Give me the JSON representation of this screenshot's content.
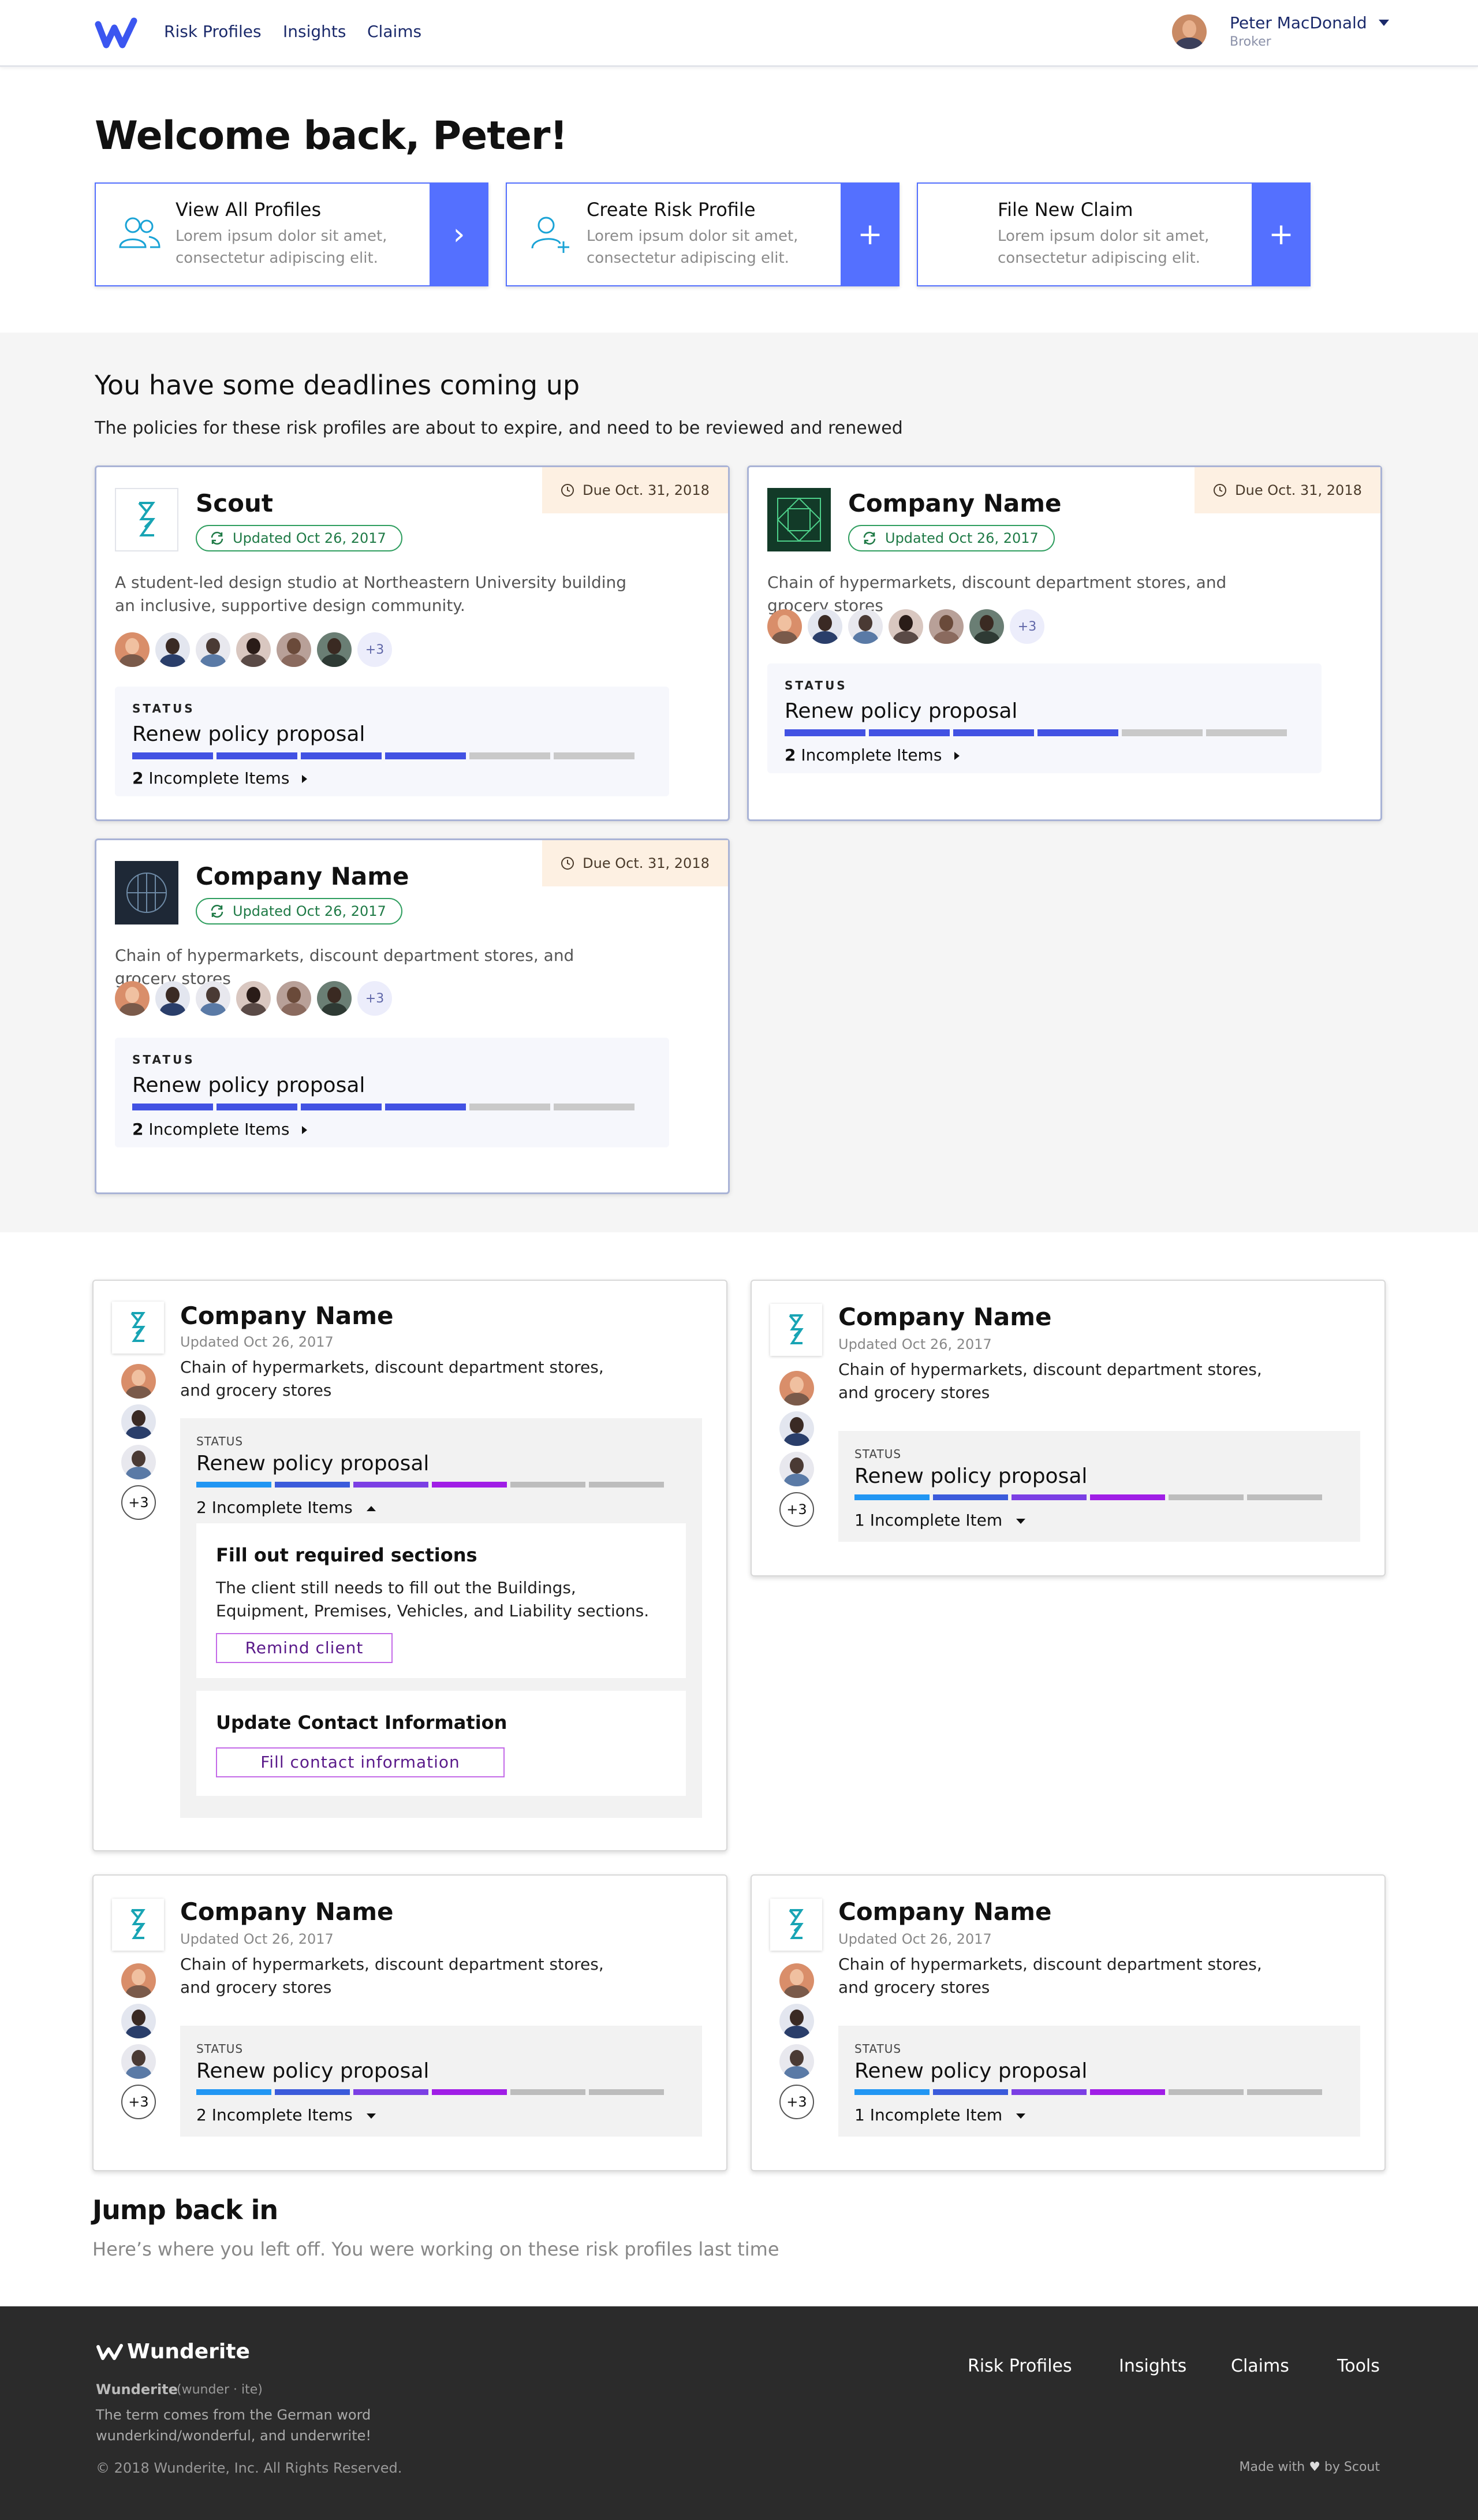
{
  "header": {
    "nav": [
      "Risk Profiles",
      "Insights",
      "Claims"
    ],
    "user_name": "Peter MacDonald",
    "user_role": "Broker"
  },
  "welcome": "Welcome back, Peter!",
  "quick_actions": [
    {
      "title": "View All Profiles",
      "desc": "Lorem ipsum dolor sit amet, consectetur adipiscing elit.",
      "button": "›"
    },
    {
      "title": "Create Risk Profile",
      "desc": "Lorem ipsum dolor sit amet, consectetur adipiscing elit.",
      "button": "+"
    },
    {
      "title": "File New Claim",
      "desc": "Lorem ipsum dolor sit amet, consectetur adipiscing elit.",
      "button": "+"
    }
  ],
  "deadlines": {
    "title": "You have some deadlines coming up",
    "subtitle": "The policies for these risk profiles are about to expire, and need to be reviewed and renewed",
    "cards": [
      {
        "name": "Scout",
        "due": "Due Oct. 31, 2018",
        "updated": "Updated Oct 26, 2017",
        "desc": "A student-led design studio at Northeastern University building an inclusive, supportive design community.",
        "more": "+3",
        "status_label": "STATUS",
        "phase": "Renew policy proposal",
        "progress": 0.67,
        "incomplete_count": "2",
        "incomplete_text": "Incomplete Items"
      },
      {
        "name": "Company Name",
        "due": "Due Oct. 31, 2018",
        "updated": "Updated Oct 26, 2017",
        "desc": "Chain of hypermarkets, discount department stores, and grocery stores",
        "more": "+3",
        "status_label": "STATUS",
        "phase": "Renew policy proposal",
        "progress": 0.67,
        "incomplete_count": "2",
        "incomplete_text": "Incomplete Items"
      },
      {
        "name": "Company Name",
        "due": "Due Oct. 31, 2018",
        "updated": "Updated Oct 26, 2017",
        "desc": "Chain of hypermarkets, discount department stores, and grocery stores",
        "more": "+3",
        "status_label": "STATUS",
        "phase": "Renew policy proposal",
        "progress": 0.67,
        "incomplete_count": "2",
        "incomplete_text": "Incomplete Items"
      }
    ]
  },
  "profiles": [
    {
      "name": "Company Name",
      "updated": "Updated Oct 26, 2017",
      "desc": "Chain of hypermarkets, discount department stores, and grocery stores",
      "more": "+3",
      "status_label": "STATUS",
      "phase": "Renew policy proposal",
      "incomplete": "2 Incomplete Items",
      "tasks": [
        {
          "title": "Fill out required sections",
          "desc": "The client still needs to fill out the Buildings, Equipment, Premises, Vehicles, and Liability sections.",
          "button": "Remind client"
        },
        {
          "title": "Update Contact Information",
          "button": "Fill contact information"
        }
      ]
    },
    {
      "name": "Company Name",
      "updated": "Updated Oct 26, 2017",
      "desc": "Chain of hypermarkets, discount department stores, and grocery stores",
      "more": "+3",
      "status_label": "STATUS",
      "phase": "Renew policy proposal",
      "incomplete": "1 Incomplete Item"
    },
    {
      "name": "Company Name",
      "updated": "Updated Oct 26, 2017",
      "desc": "Chain of hypermarkets, discount department stores, and grocery stores",
      "more": "+3",
      "status_label": "STATUS",
      "phase": "Renew policy proposal",
      "incomplete": "2 Incomplete Items"
    },
    {
      "name": "Company Name",
      "updated": "Updated Oct 26, 2017",
      "desc": "Chain of hypermarkets, discount department stores, and grocery stores",
      "more": "+3",
      "status_label": "STATUS",
      "phase": "Renew policy proposal",
      "incomplete": "1 Incomplete Item"
    }
  ],
  "jump_back": {
    "title": "Jump back in",
    "subtitle": "Here’s where you left off. You were working on these risk profiles last time"
  },
  "footer": {
    "brand": "Wunderite",
    "word": "Wunderite",
    "pronunciation": "(wunder · ite)",
    "definition": "The term comes from the German word wunderkind/wonderful, and underwrite!",
    "copyright": "© 2018 Wunderite, Inc. All Rights Reserved.",
    "nav": [
      "Risk Profiles",
      "Insights",
      "Claims",
      "Tools"
    ],
    "made_with_prefix": "Made with",
    "made_with_suffix": "by Scout"
  },
  "colors": {
    "accent": "#5470ff",
    "progress": "#4252e3",
    "due_bg": "#fdf0e2",
    "footer_bg": "#2b2b2b"
  }
}
